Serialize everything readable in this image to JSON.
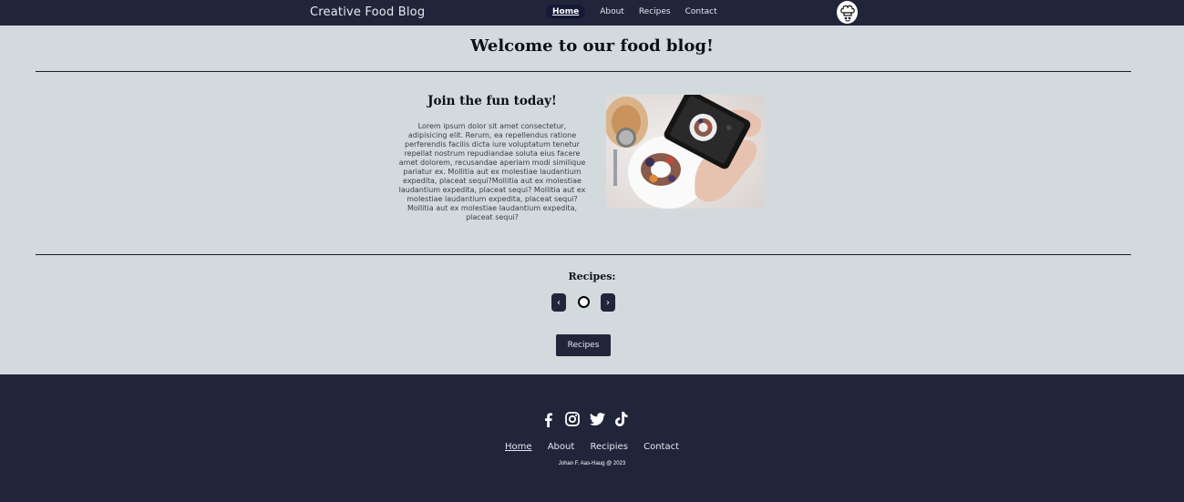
{
  "header": {
    "brand": "Creative Food Blog",
    "nav": [
      {
        "label": "Home",
        "active": true
      },
      {
        "label": "About"
      },
      {
        "label": "Recipes"
      },
      {
        "label": "Contact"
      }
    ],
    "logo_icon": "chef-hat-icon"
  },
  "main": {
    "welcome": "Welcome to our food blog!",
    "join_title": "Join the fun today!",
    "lorem": "Lorem ipsum dolor sit amet consectetur, adipisicing elit. Rerum, ea repellendus ratione perferendis facilis dicta iure voluptatum tenetur repellat nostrum repudiandae soluta eius facere amet dolorem, recusandae aperiam modi similique pariatur ex. Mollitia aut ex molestiae laudantium expedita, placeat sequi?Mollitia aut ex molestiae laudantium expedita, placeat sequi? Mollitia aut ex molestiae laudantium expedita, placeat sequi?Mollitia aut ex molestiae laudantium expedita, placeat sequi?",
    "photo_icon": "phone-photographing-cake-image",
    "recipes_title": "Recipes:",
    "carousel": {
      "prev": "‹",
      "next": "›"
    },
    "recipes_button": "Recipes"
  },
  "footer": {
    "socials": [
      "facebook-icon",
      "instagram-icon",
      "twitter-icon",
      "tiktok-icon"
    ],
    "nav": [
      "Home",
      "About",
      "Recipies",
      "Contact"
    ],
    "copyright": "Johan F. Aas-Haug @ 2023"
  },
  "colors": {
    "navy": "#20253a",
    "page_bg": "#d3dade"
  }
}
